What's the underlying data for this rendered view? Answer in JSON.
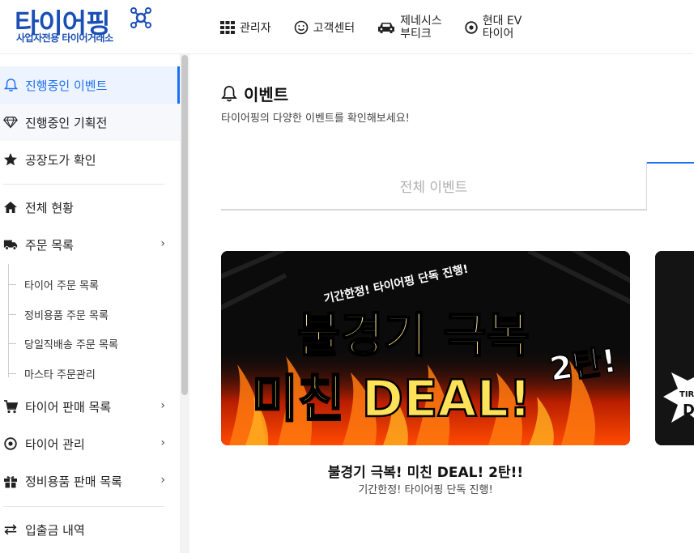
{
  "brand": {
    "logo_text": "타이어핑",
    "tagline": "사업자전용 타이어거래소",
    "colors": {
      "primary": "#1a4fb5",
      "accent": "#1d6ff2"
    }
  },
  "topnav": {
    "items": [
      {
        "label": "관리자",
        "icon": "grid-icon"
      },
      {
        "label": "고객센터",
        "icon": "smile-icon"
      },
      {
        "label_line1": "제네시스",
        "label_line2": "부티크",
        "icon": "car-icon"
      },
      {
        "label_line1": "현대 EV",
        "label_line2": "타이어",
        "icon": "target-icon"
      }
    ]
  },
  "sidebar": {
    "items": [
      {
        "label": "진행중인 이벤트",
        "icon": "bell-icon",
        "active": true
      },
      {
        "label": "진행중인 기획전",
        "icon": "diamond-icon"
      },
      {
        "label": "공장도가 확인",
        "icon": "star-icon"
      },
      {
        "label": "전체 현황",
        "icon": "home-icon"
      },
      {
        "label": "주문 목록",
        "icon": "truck-icon",
        "expandable": true
      },
      {
        "label": "타이어 판매 목록",
        "icon": "cart-icon",
        "expandable": true
      },
      {
        "label": "타이어 관리",
        "icon": "target-icon",
        "expandable": true
      },
      {
        "label": "정비용품 판매 목록",
        "icon": "gift-icon",
        "expandable": true
      },
      {
        "label": "입출금 내역",
        "icon": "transfer-icon"
      }
    ],
    "sub_items": [
      {
        "label": "타이어 주문 목록"
      },
      {
        "label": "정비용품 주문 목록"
      },
      {
        "label": "당일직배송 주문 목록"
      },
      {
        "label": "마스타 주문관리"
      }
    ],
    "chevron": "›"
  },
  "main": {
    "title": "이벤트",
    "subtitle": "타이어핑의 다양한 이벤트를 확인해보세요!",
    "tab_label": "전체 이벤트",
    "event_card": {
      "banner_top_text": "기간한정! 타이어핑 단독 진행!",
      "banner_line1": "불경기 극복",
      "banner_line2": "미친 DEAL!",
      "banner_badge": "2탄!",
      "title": "불경기 극복! 미친 DEAL! 2탄!!",
      "subtitle": "기간한정! 타이어핑 단독 진행!"
    },
    "next_card_partial_text": "TIRE",
    "next_card_partial_letter": "D"
  }
}
